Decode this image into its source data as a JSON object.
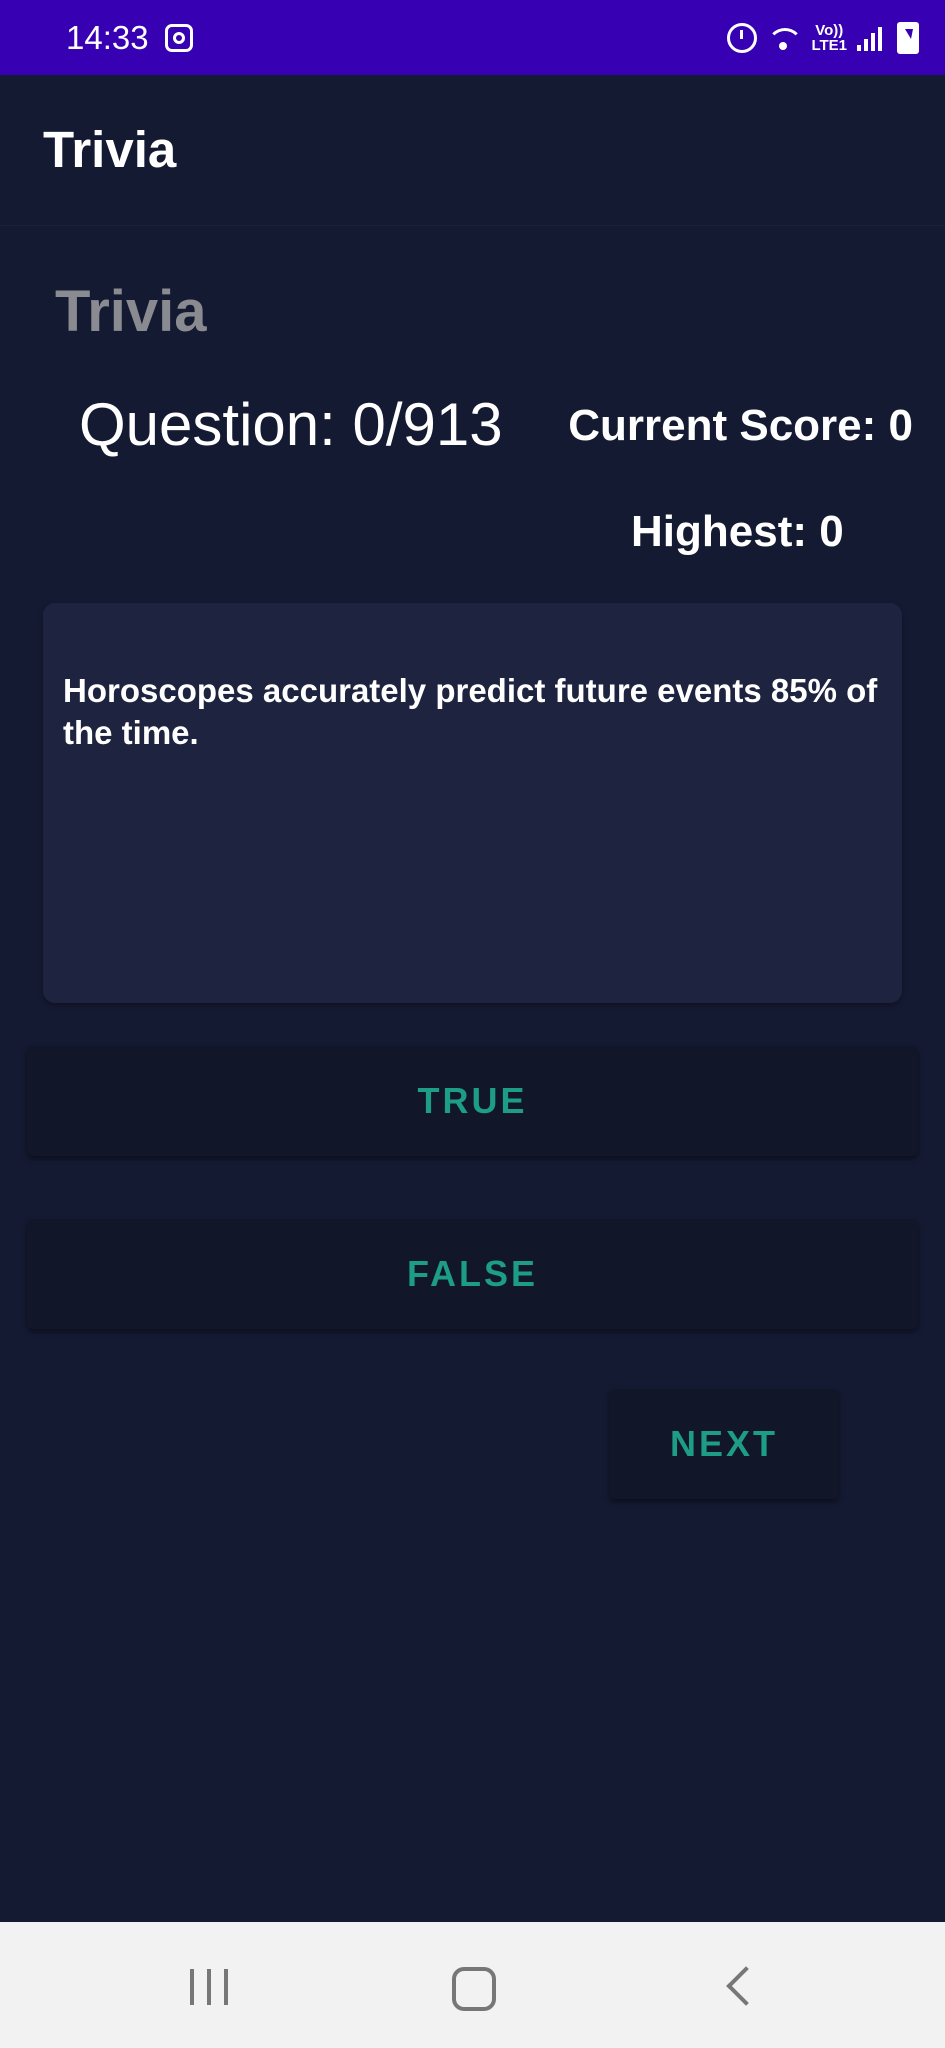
{
  "status_bar": {
    "time": "14:33",
    "lte_label_top": "Vo))",
    "lte_label_bottom": "LTE1",
    "icons": [
      "instagram-icon",
      "alarm-icon",
      "wifi-icon",
      "lte-icon",
      "signal-icon",
      "battery-charging-icon"
    ]
  },
  "app_bar": {
    "title": "Trivia"
  },
  "main": {
    "heading": "Trivia",
    "question_counter": "Question: 0/913",
    "current_score": "Current Score: 0",
    "highest_score": "Highest: 0",
    "question_text": "Horoscopes accurately predict future events 85% of the time.",
    "buttons": {
      "true_label": "TRUE",
      "false_label": "FALSE",
      "next_label": "NEXT"
    }
  },
  "nav_bar": {
    "icons": [
      "recents-icon",
      "home-icon",
      "back-icon"
    ]
  },
  "colors": {
    "status_bar": "#3700b3",
    "background": "#151a33",
    "card": "#1e2340",
    "button": "#111629",
    "button_text": "#1e9d86",
    "heading_muted": "#8a8a91",
    "nav_bar": "#f2f2f2"
  }
}
